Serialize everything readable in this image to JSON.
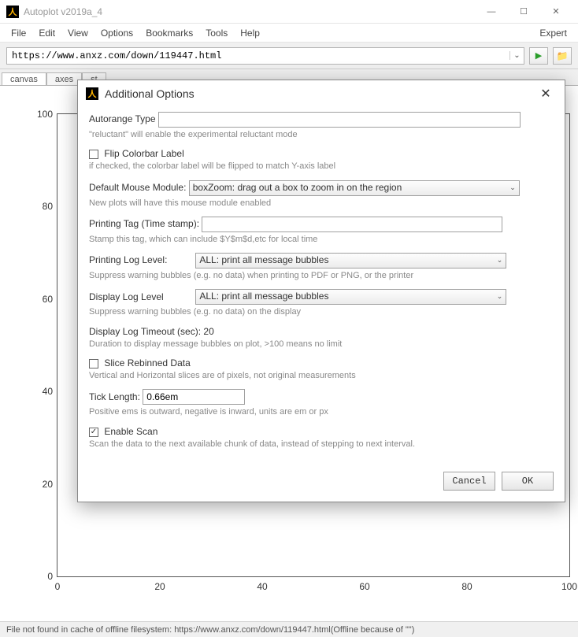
{
  "window": {
    "title": "Autoplot v2019a_4"
  },
  "menubar": {
    "file": "File",
    "edit": "Edit",
    "view": "View",
    "options": "Options",
    "bookmarks": "Bookmarks",
    "tools": "Tools",
    "help": "Help",
    "expert": "Expert"
  },
  "address": {
    "url": "https://www.anxz.com/down/119447.html"
  },
  "tabs": {
    "canvas": "canvas",
    "axes": "axes",
    "style": "st"
  },
  "chart_data": {
    "type": "scatter",
    "title": "",
    "xlabel": "",
    "ylabel": "",
    "xlim": [
      0,
      100
    ],
    "ylim": [
      0,
      100
    ],
    "x_ticks": [
      0,
      20,
      40,
      60,
      80,
      100
    ],
    "y_ticks": [
      0,
      20,
      40,
      60,
      80,
      100
    ],
    "series": []
  },
  "statusbar": {
    "text": "File not found in cache of offline filesystem: https://www.anxz.com/down/119447.html(Offline because of \"\")"
  },
  "dialog": {
    "title": "Additional Options",
    "autorange_type": {
      "label": "Autorange Type",
      "value": "",
      "hint": "\"reluctant\" will enable the experimental reluctant mode"
    },
    "flip_colorbar": {
      "label": "Flip Colorbar Label",
      "hint": "if checked, the colorbar label will be flipped to match Y-axis label"
    },
    "default_mouse": {
      "label": "Default Mouse Module:",
      "value": "boxZoom: drag out a box to zoom in on the region",
      "hint": "New plots will have this mouse module enabled"
    },
    "printing_tag": {
      "label": "Printing Tag (Time stamp):",
      "value": "",
      "hint": "Stamp this tag, which can include $Y$m$d,etc for local time"
    },
    "printing_log": {
      "label": "Printing Log Level:",
      "value": "ALL: print all message bubbles",
      "hint": "Suppress warning bubbles (e.g. no data) when printing to PDF or PNG, or the printer"
    },
    "display_log": {
      "label": "Display Log Level",
      "value": "ALL: print all message bubbles",
      "hint": "Suppress warning bubbles (e.g. no data) on the display"
    },
    "display_timeout": {
      "label": "Display Log Timeout (sec):",
      "value": "20",
      "hint": "Duration to display message bubbles on plot, >100 means no limit"
    },
    "slice_rebinned": {
      "label": "Slice Rebinned Data",
      "hint": "Vertical and Horizontal slices are of pixels, not original measurements"
    },
    "tick_length": {
      "label": "Tick Length:",
      "value": "0.66em",
      "hint": "Positive ems is outward, negative is inward, units are em or px"
    },
    "enable_scan": {
      "label": "Enable Scan",
      "hint": "Scan the data to the next available chunk of data, instead of stepping to next interval."
    },
    "buttons": {
      "cancel": "Cancel",
      "ok": "OK"
    }
  }
}
